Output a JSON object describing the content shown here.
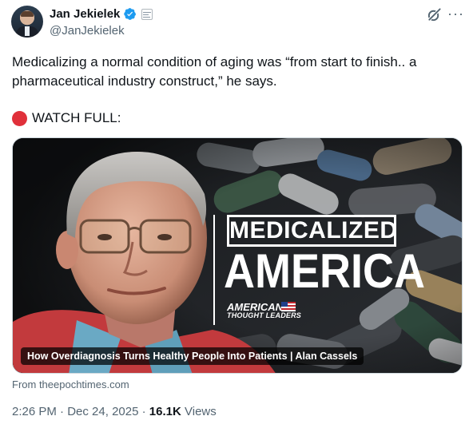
{
  "author": {
    "display_name": "Jan Jekielek",
    "handle": "@JanJekielek",
    "verified_color": "#1d9bf0"
  },
  "tweet": {
    "text": "Medicalizing a normal condition of aging was “from start to finish.. a pharmaceutical industry construct,” he says.",
    "watch_label": "WATCH FULL:"
  },
  "media": {
    "title_top": "MEDICALIZED",
    "title_main": "AMERICA",
    "brand_line1": "AMERICAN",
    "brand_line2": "THOUGHT LEADERS",
    "caption": "How Overdiagnosis Turns Healthy People Into Patients | Alan Cassels"
  },
  "source": "From theepochtimes.com",
  "meta": {
    "time": "2:26 PM",
    "date": "Dec 24, 2025",
    "views_count": "16.1K",
    "views_label": "Views"
  },
  "icons": {
    "verified": "verified-badge-icon",
    "affiliation": "affiliation-badge-icon",
    "grok": "grok-icon",
    "more": "more-icon",
    "red_circle": "red-circle-icon",
    "flag": "us-flag-icon"
  }
}
